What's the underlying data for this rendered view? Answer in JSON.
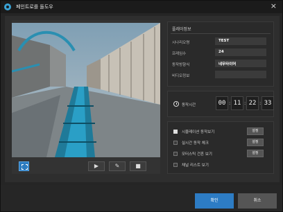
{
  "window": {
    "title": "페인트로를 돌도우"
  },
  "video": {
    "controls": {
      "play_icon": "▶",
      "edit_icon": "✎",
      "stop_icon": "■"
    }
  },
  "info": {
    "title": "플레이정보",
    "rows": [
      {
        "label": "시나리오명",
        "value": "TEST"
      },
      {
        "label": "프레임수",
        "value": "24"
      },
      {
        "label": "동작방향식",
        "value": "네무타이머"
      },
      {
        "label": "비디오정보",
        "value": ""
      }
    ]
  },
  "time": {
    "label": "동작시간",
    "hours": "00",
    "minutes": "11",
    "seconds": "22",
    "frames": "33",
    "separator": ":"
  },
  "options": [
    {
      "label": "시뮬레이션 동작보기",
      "checked": true,
      "button": "설정"
    },
    {
      "label": "실시간 동작 체크",
      "checked": false,
      "button": "설정"
    },
    {
      "label": "모터스틱 건흔 보기",
      "checked": false,
      "button": "설정"
    },
    {
      "label": "채널 리스트 보기",
      "checked": false,
      "button": ""
    }
  ],
  "footer": {
    "confirm_label": "확인",
    "cancel_label": "취소"
  },
  "colors": {
    "accent": "#2d7cc4"
  }
}
